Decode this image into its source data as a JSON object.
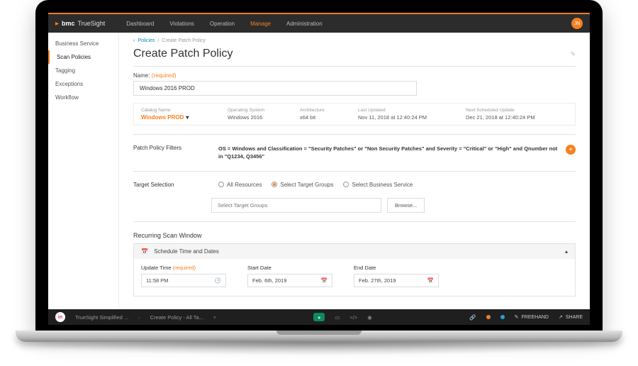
{
  "brand": {
    "primary": "bmc",
    "secondary": "TrueSight",
    "avatar": "JN"
  },
  "nav": {
    "items": [
      {
        "label": "Dashboard"
      },
      {
        "label": "Violations"
      },
      {
        "label": "Operation"
      },
      {
        "label": "Manage",
        "active": true
      },
      {
        "label": "Administration"
      }
    ]
  },
  "sidebar": {
    "items": [
      {
        "label": "Business Service"
      },
      {
        "label": "Scan Policies",
        "active": true
      },
      {
        "label": "Tagging"
      },
      {
        "label": "Exceptions"
      },
      {
        "label": "Workflow"
      }
    ]
  },
  "breadcrumb": {
    "link": "Policies",
    "current": "Create Patch Policy"
  },
  "page": {
    "title": "Create Patch Policy"
  },
  "form": {
    "name_label": "Name:",
    "required_text": "(required)",
    "name_value": "Windows 2016 PROD"
  },
  "catalog": {
    "headers": {
      "name": "Catalog Name",
      "os": "Operating System",
      "arch": "Architecture",
      "last": "Last Updated",
      "next": "Next Scheduled Update"
    },
    "values": {
      "name": "Windows PROD",
      "os": "Windows 2016",
      "arch": "x64 bit",
      "last": "Nov 11, 2018 at 12:40:24 PM",
      "next": "Dec 21, 2018 at 12:40:24 PM"
    }
  },
  "filters": {
    "label": "Patch Policy  Filters",
    "text": "OS = Windows and Classification = \"Security Patches\" or \"Non Security Patches\" and Severity = \"Critical\" or \"High\" and Qnumber not in \"Q1234, Q3456\""
  },
  "target": {
    "label": "Target Selection",
    "options": {
      "all": "All Resources",
      "groups": "Select Target Groups",
      "biz": "Select Business Service"
    },
    "groups_placeholder": "Select Target Groups",
    "browse": "Browse..."
  },
  "recurring": {
    "title": "Recurring Scan Window",
    "schedule_head": "Schedule Time and Dates",
    "update_time_label": "Update Time",
    "update_time_value": "11:58 PM",
    "start_label": "Start Date",
    "start_value": "Feb. 6th, 2019",
    "end_label": "End Date",
    "end_value": "Feb. 27th, 2019"
  },
  "bottombar": {
    "project": "TrueSight Simplified ...",
    "page": "Create Policy - All Ta...",
    "freehand": "FREEHAND",
    "share": "SHARE"
  }
}
